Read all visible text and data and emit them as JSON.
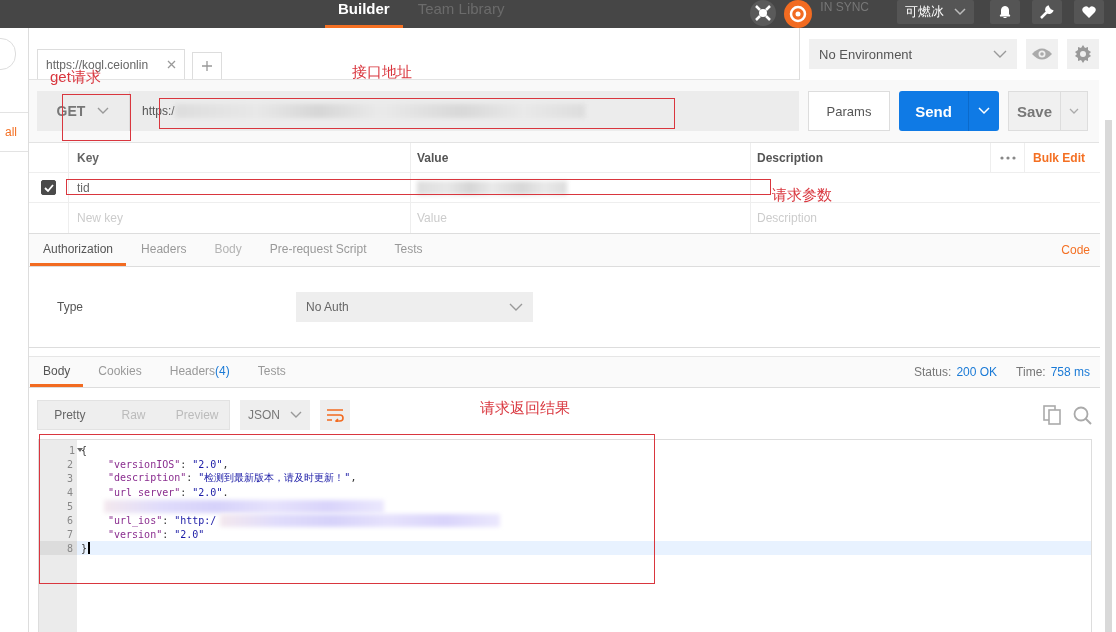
{
  "top_bar": {
    "nav": [
      {
        "label": "Builder",
        "selected": true
      },
      {
        "label": "Team Library",
        "selected": false
      }
    ],
    "sync_status": "IN SYNC",
    "user": "可燃冰"
  },
  "sidebar": {
    "link": "all"
  },
  "request_tabs": [
    {
      "label": "https://kogl.ceionlin"
    }
  ],
  "environment": {
    "value": "No Environment"
  },
  "request": {
    "method": "GET",
    "method_annotation": "get请求",
    "url": "https:/",
    "url_redacted": true,
    "url_annotation": "接口地址",
    "params_button": "Params",
    "send_button": "Send",
    "save_button": "Save"
  },
  "params": {
    "columns": [
      "Key",
      "Value",
      "Description"
    ],
    "bulk_edit": "Bulk Edit",
    "annotation": "请求参数",
    "rows": [
      {
        "checked": true,
        "key": "tid",
        "value_redacted": true
      }
    ],
    "new_row": {
      "key_placeholder": "New key",
      "value_placeholder": "Value",
      "description_placeholder": "Description"
    }
  },
  "request_sections": [
    {
      "label": "Authorization",
      "selected": true,
      "disabled": false
    },
    {
      "label": "Headers",
      "selected": false,
      "disabled": false
    },
    {
      "label": "Body",
      "selected": false,
      "disabled": true
    },
    {
      "label": "Pre-request Script",
      "selected": false,
      "disabled": false
    },
    {
      "label": "Tests",
      "selected": false,
      "disabled": false
    }
  ],
  "code_link": "Code",
  "auth": {
    "label": "Type",
    "value": "No Auth"
  },
  "response_tabs": [
    {
      "label": "Body",
      "selected": true
    },
    {
      "label": "Cookies",
      "selected": false
    },
    {
      "label": "Headers",
      "count": "(4)",
      "selected": false
    },
    {
      "label": "Tests",
      "selected": false
    }
  ],
  "status": {
    "status_label": "Status:",
    "status_value": "200 OK",
    "time_label": "Time:",
    "time_value": "758 ms"
  },
  "view_modes": [
    {
      "label": "Pretty",
      "selected": true
    },
    {
      "label": "Raw",
      "selected": false
    },
    {
      "label": "Preview",
      "selected": false
    }
  ],
  "format": "JSON",
  "response_annotation": "请求返回结果",
  "lines": [
    {
      "number": "1",
      "foldable": true,
      "indented": false,
      "current": false,
      "redacted": false,
      "tokens": [
        {
          "kind": "punct",
          "text": "{"
        }
      ]
    },
    {
      "number": "2",
      "foldable": false,
      "indented": true,
      "current": false,
      "redacted": false,
      "tokens": [
        {
          "kind": "key",
          "text": "\"versionIOS\""
        },
        {
          "kind": "punct",
          "text": ": "
        },
        {
          "kind": "string",
          "text": "\"2.0\""
        },
        {
          "kind": "punct",
          "text": ","
        }
      ]
    },
    {
      "number": "3",
      "foldable": false,
      "indented": true,
      "current": false,
      "redacted": false,
      "tokens": [
        {
          "kind": "key",
          "text": "\"description\""
        },
        {
          "kind": "punct",
          "text": ": "
        },
        {
          "kind": "string",
          "text": "\"检测到最新版本，请及时更新！\""
        },
        {
          "kind": "punct",
          "text": ","
        }
      ]
    },
    {
      "number": "4",
      "foldable": false,
      "indented": true,
      "current": false,
      "redacted": false,
      "tokens": [
        {
          "kind": "key",
          "text": "\"url server\""
        },
        {
          "kind": "punct",
          "text": ": "
        },
        {
          "kind": "string",
          "text": "\"2.0\""
        },
        {
          "kind": "punct",
          "text": "."
        }
      ]
    },
    {
      "number": "5",
      "foldable": false,
      "indented": true,
      "current": false,
      "redacted": true
    },
    {
      "number": "6",
      "foldable": false,
      "indented": true,
      "current": false,
      "redacted": true,
      "tokens": [
        {
          "kind": "key",
          "text": "\"url_ios\""
        },
        {
          "kind": "punct",
          "text": ": "
        },
        {
          "kind": "string",
          "text": "\"http:/"
        }
      ]
    },
    {
      "number": "7",
      "foldable": false,
      "indented": true,
      "current": false,
      "redacted": false,
      "tokens": [
        {
          "kind": "key",
          "text": "\"version\""
        },
        {
          "kind": "punct",
          "text": ": "
        },
        {
          "kind": "string",
          "text": "\"2.0\""
        }
      ]
    },
    {
      "number": "8",
      "foldable": false,
      "indented": false,
      "current": true,
      "redacted": false,
      "tokens": [
        {
          "kind": "punct",
          "text": "}"
        }
      ]
    }
  ]
}
